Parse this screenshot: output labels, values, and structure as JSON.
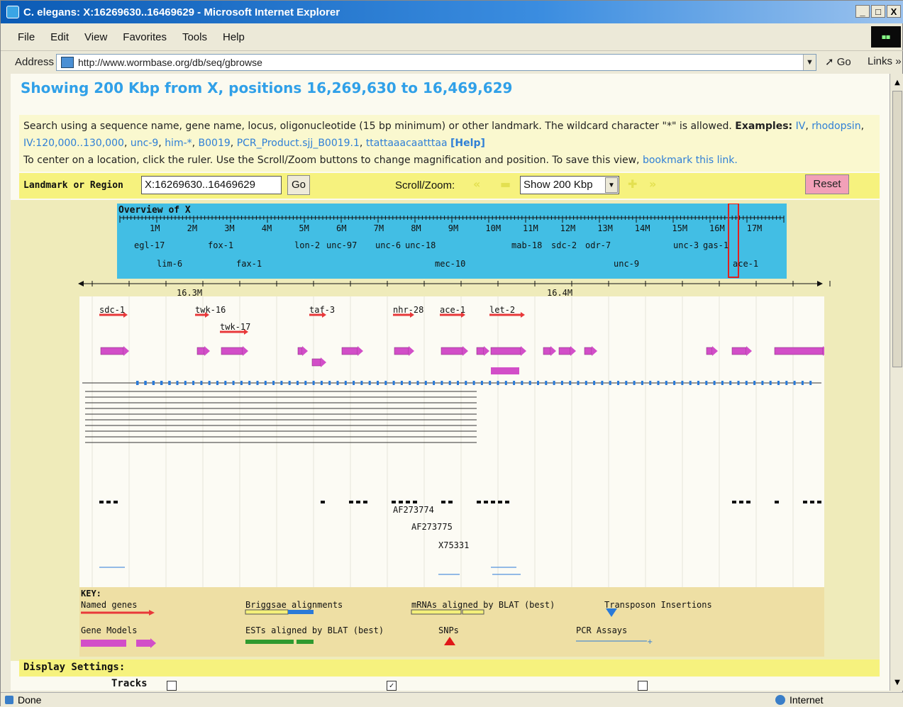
{
  "window": {
    "title": "C. elegans: X:16269630..16469629 - Microsoft Internet Explorer",
    "controls": [
      "_",
      "□",
      "X"
    ]
  },
  "menu": [
    "File",
    "Edit",
    "View",
    "Favorites",
    "Tools",
    "Help"
  ],
  "address": {
    "label": "Address",
    "url": "http://www.wormbase.org/db/seq/gbrowse",
    "go": "Go",
    "links": "Links"
  },
  "page": {
    "heading": "Showing 200 Kbp from X, positions 16,269,630 to 16,469,629",
    "search_text": "Search using a sequence name, gene name, locus, oligonucleotide (15 bp minimum) or other landmark. The wildcard character \"*\" is allowed.",
    "examples_label": "Examples:",
    "examples": [
      "IV",
      "rhodopsin",
      "IV:120,000..130,000",
      "unc-9",
      "him-*",
      "B0019",
      "PCR_Product.sjj_B0019.1",
      "ttattaaacaatttaa"
    ],
    "help": "[Help]",
    "center_text": "To center on a location, click the ruler. Use the Scroll/Zoom buttons to change magnification and position. To save this view,",
    "bookmark": "bookmark this link.",
    "landmark_label": "Landmark or Region",
    "landmark_value": "X:16269630..16469629",
    "go": "Go",
    "scroll_label": "Scroll/Zoom:",
    "zoom_value": "Show 200 Kbp",
    "reset": "Reset",
    "display_settings": "Display Settings:",
    "tracks_label": "Tracks"
  },
  "overview": {
    "label": "Overview of X",
    "ticks": [
      "1M",
      "2M",
      "3M",
      "4M",
      "5M",
      "6M",
      "7M",
      "8M",
      "9M",
      "10M",
      "11M",
      "12M",
      "13M",
      "14M",
      "15M",
      "16M",
      "17M"
    ],
    "genes_row1": [
      "egl-17",
      "fox-1",
      "lon-2",
      "unc-97",
      "unc-6",
      "unc-18",
      "mab-18",
      "sdc-2",
      "odr-7",
      "unc-3",
      "gas-1"
    ],
    "genes_row2": [
      "lim-6",
      "fax-1",
      "mec-10",
      "unc-9",
      "ace-1"
    ]
  },
  "detail": {
    "ruler": [
      "16.3M",
      "16.4M"
    ],
    "named_genes": [
      "sdc-1",
      "twk-16",
      "twk-17",
      "taf-3",
      "nhr-28",
      "ace-1",
      "let-2"
    ],
    "accessions": [
      "AF273774",
      "AF273775",
      "X75331"
    ]
  },
  "key": {
    "title": "KEY:",
    "items": [
      "Named genes",
      "Briggsae alignments",
      "mRNAs aligned by BLAT (best)",
      "Transposon Insertions",
      "Gene Models",
      "ESTs aligned by BLAT (best)",
      "SNPs",
      "PCR Assays"
    ]
  },
  "status": {
    "left": "Done",
    "zone": "Internet"
  },
  "colors": {
    "named_gene": "#e8383a",
    "gene_model": "#d24ec8",
    "alignment": "#2a7ad8",
    "snp": "#e01818",
    "overview_bg": "#42bee4"
  }
}
